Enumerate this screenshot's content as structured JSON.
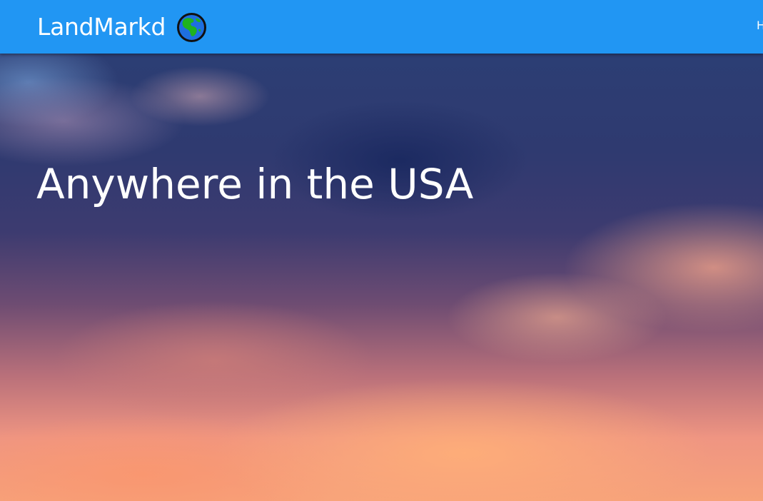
{
  "navbar": {
    "brand_name": "LandMarkd",
    "brand_icon": "globe-icon",
    "cut_off_link": "H",
    "background_color": "#2196f3"
  },
  "hero": {
    "title": "Anywhere in the USA",
    "background": "sunset-sky-with-clouds"
  }
}
